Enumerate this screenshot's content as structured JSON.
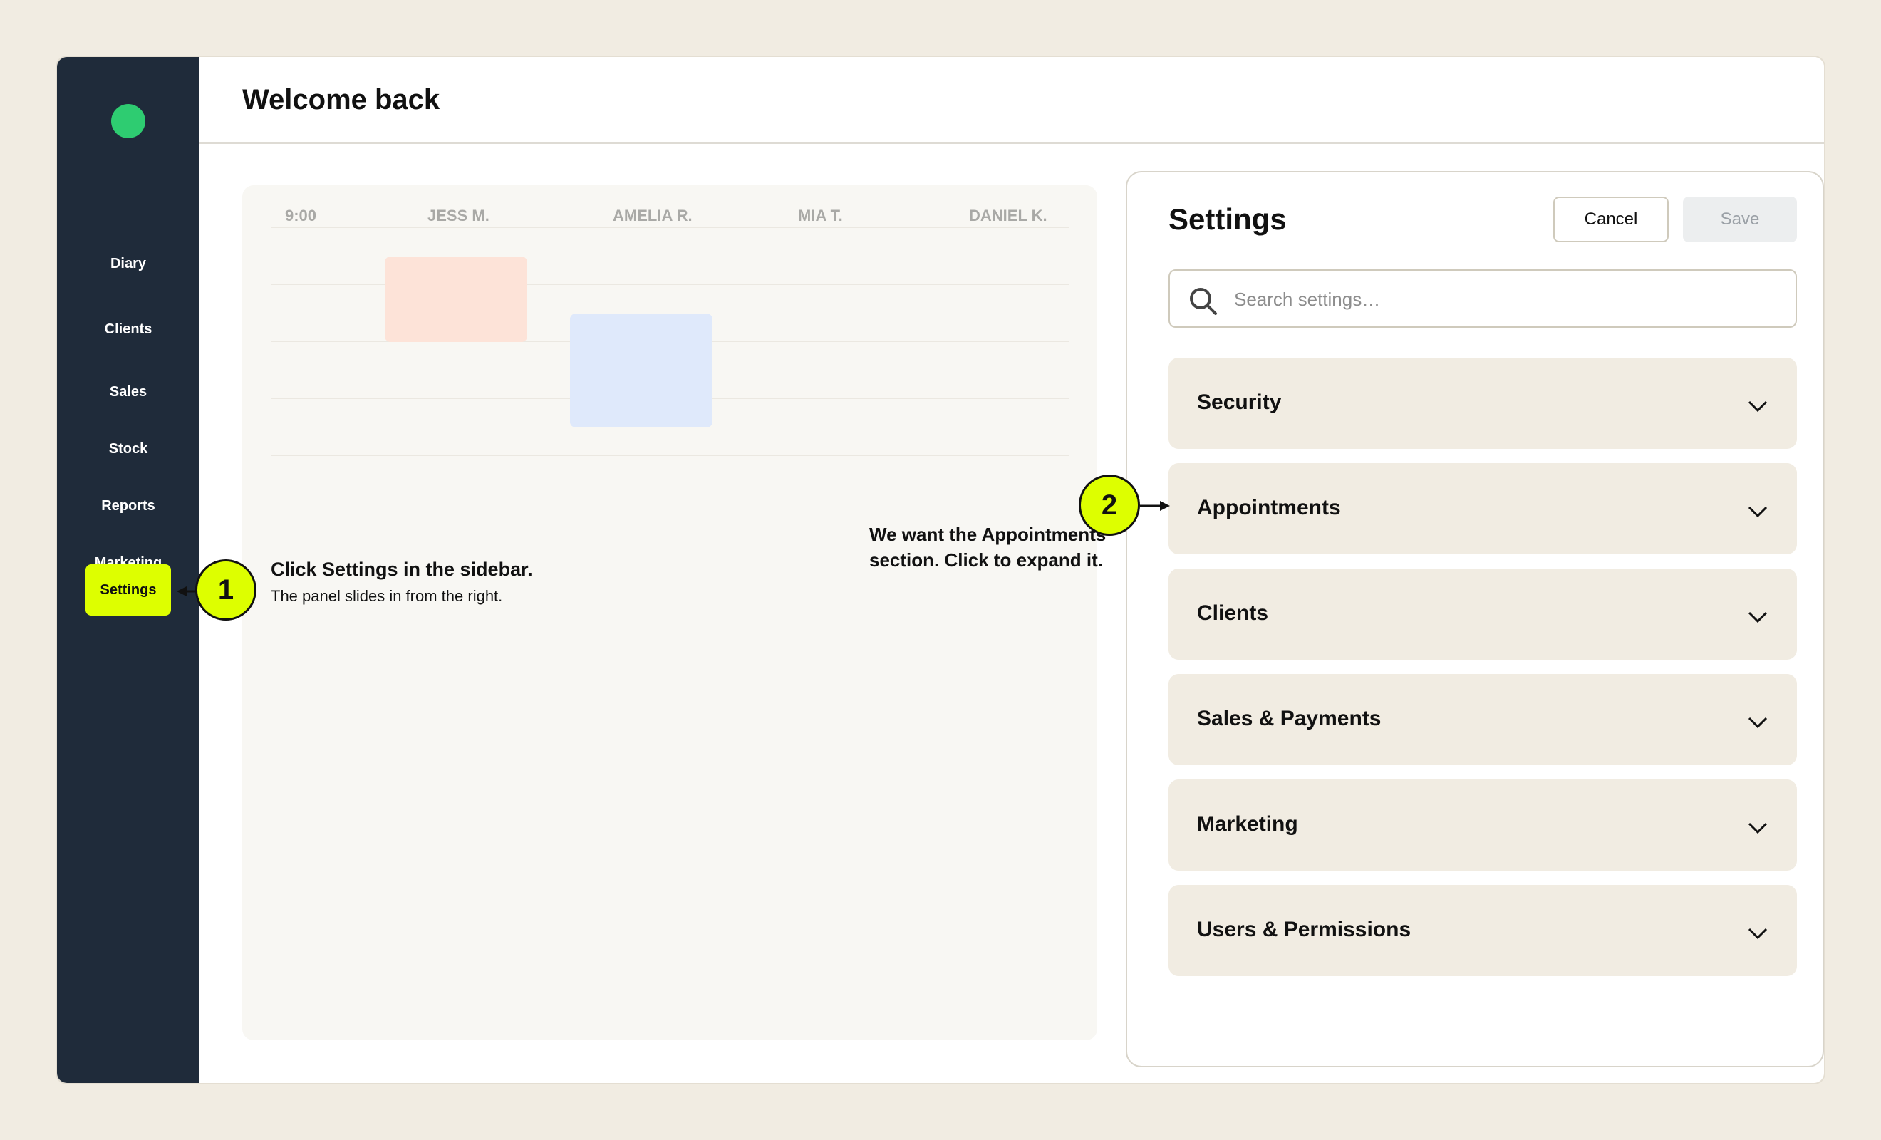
{
  "header": {
    "title": "Welcome back"
  },
  "sidebar": {
    "items": [
      {
        "label": "Diary"
      },
      {
        "label": "Clients"
      },
      {
        "label": "Sales"
      },
      {
        "label": "Stock"
      },
      {
        "label": "Reports"
      },
      {
        "label": "Marketing"
      },
      {
        "label": "Settings",
        "active": true
      }
    ]
  },
  "diary": {
    "columns": [
      "9:00",
      "JESS M.",
      "AMELIA R.",
      "MIA T.",
      "DANIEL K."
    ],
    "appointment_colors": [
      "#fde3d8",
      "#dfe9fb"
    ]
  },
  "settings_panel": {
    "title": "Settings",
    "cancel_label": "Cancel",
    "save_label": "Save",
    "search_placeholder": "Search settings…",
    "sections": [
      {
        "label": "Security"
      },
      {
        "label": "Appointments"
      },
      {
        "label": "Clients"
      },
      {
        "label": "Sales & Payments"
      },
      {
        "label": "Marketing"
      },
      {
        "label": "Users & Permissions"
      }
    ]
  },
  "callouts": [
    {
      "number": "1",
      "title": "Click Settings in the sidebar.",
      "subtitle": "The panel slides in from the right."
    },
    {
      "number": "2",
      "title": "We want the Appointments section. Click to expand it."
    }
  ],
  "colors": {
    "accent": "#ddff00",
    "sidebar_bg": "#1f2b3a",
    "logo": "#2ecc71",
    "section_bg": "#f1ece2"
  }
}
